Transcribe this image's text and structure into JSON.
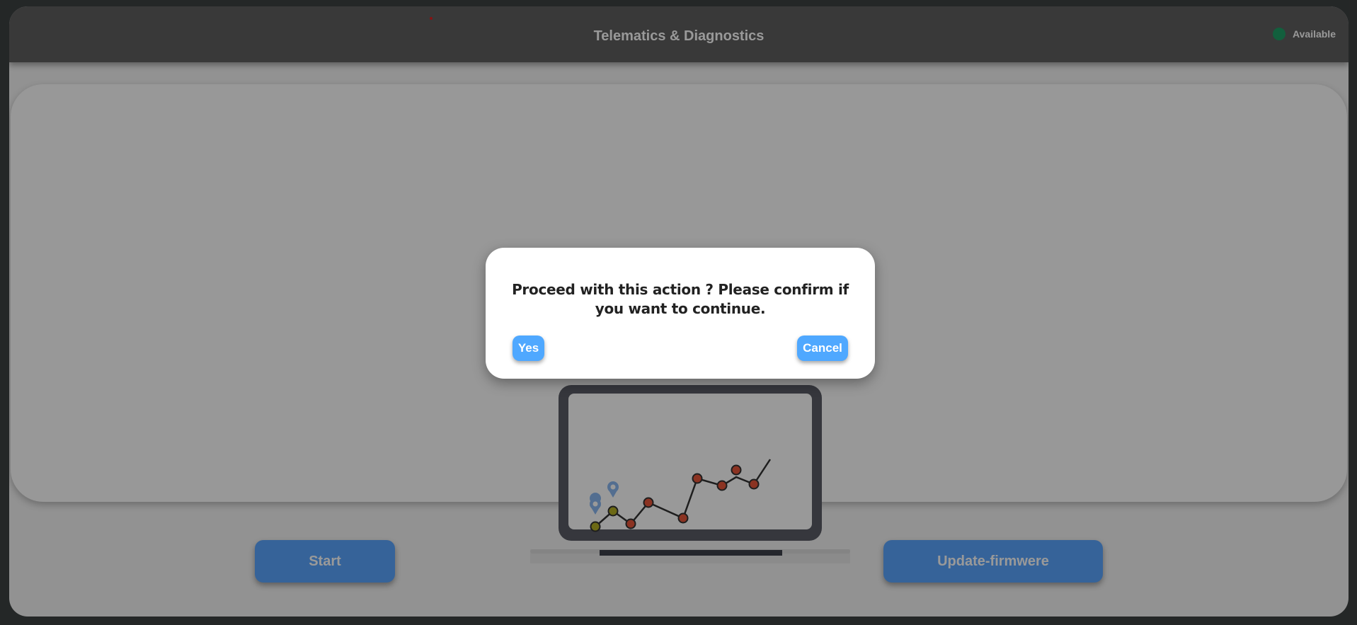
{
  "header": {
    "title": "Telematics & Diagnostics",
    "status_label": "Available",
    "status_color": "#1f9e66"
  },
  "illustration": {
    "icon": "laptop-line-chart-illustration"
  },
  "actions": {
    "start_label": "Start",
    "update_label": "Update-firmwere"
  },
  "dialog": {
    "message": "Proceed with this action ? Please confirm if you want to continue.",
    "yes_label": "Yes",
    "cancel_label": "Cancel"
  },
  "colors": {
    "accent": "#5aa5ff",
    "header_bg": "#5f5f5f"
  }
}
